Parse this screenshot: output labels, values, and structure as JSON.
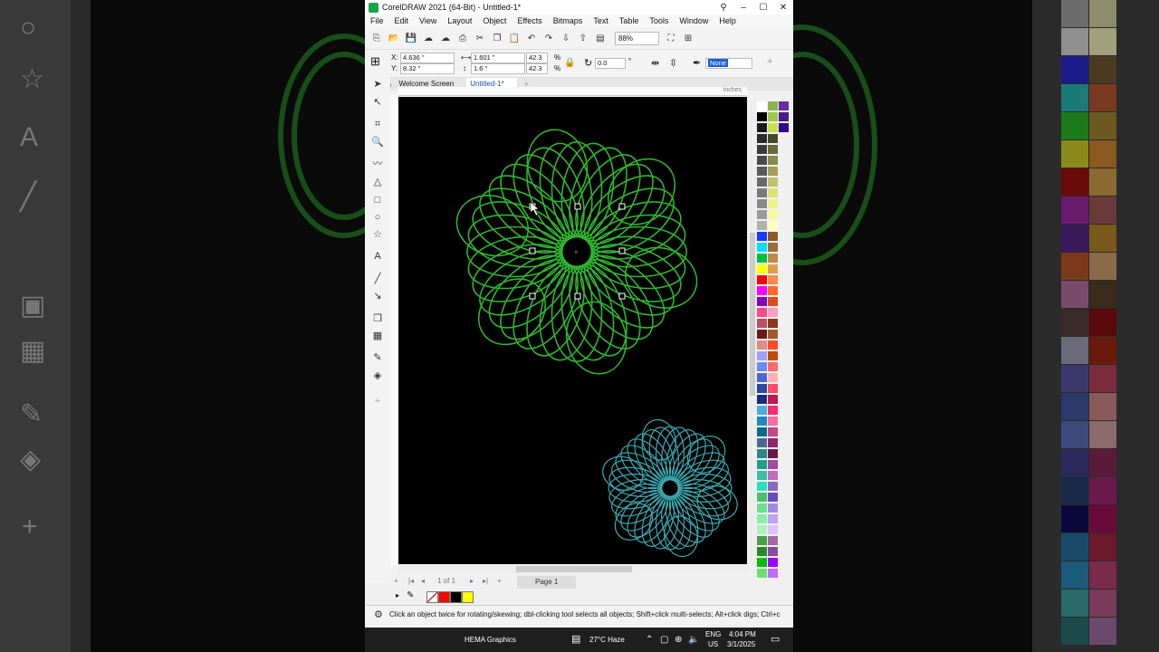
{
  "window": {
    "title": "CorelDRAW 2021 (64-Bit) - Untitled-1*",
    "controls": [
      "–",
      "☐",
      "✕"
    ]
  },
  "menu": [
    "File",
    "Edit",
    "View",
    "Layout",
    "Object",
    "Effects",
    "Bitmaps",
    "Text",
    "Table",
    "Tools",
    "Window",
    "Help"
  ],
  "toolbar": {
    "zoom": "88%"
  },
  "property_bar": {
    "x": "4.636 \"",
    "y": "8.32 \"",
    "width": "1.601 \"",
    "height": "1.6 \"",
    "scale_x": "42.3",
    "scale_y": "42.3",
    "pct": "%",
    "angle": "0.0",
    "angle_unit": "°",
    "outline": "None"
  },
  "tabs": [
    "Welcome Screen",
    "Untitled-1*"
  ],
  "ruler": {
    "unit": "inches"
  },
  "pages": {
    "count": "1 of 1",
    "page_tab": "Page 1"
  },
  "document_palette": {
    "colors": [
      "#ff0000",
      "#000000",
      "#ffff00"
    ]
  },
  "status_text": "Click an object twice for rotating/skewing; dbl-clicking tool selects all objects; Shift+click multi-selects; Alt+click digs; Ctrl+c",
  "taskbar": {
    "app": "HEMA Graphics",
    "weather": "27°C  Haze",
    "lang1": "ENG",
    "lang2": "US",
    "time": "4:04 PM",
    "date": "3/1/2025"
  },
  "artwork": {
    "flower_large_color": "#2fb52f",
    "flower_small_color": "#3aa9b3"
  },
  "icons": {
    "tools": [
      "pick-tool-icon",
      "shape-tool-icon",
      "crop-tool-icon",
      "zoom-tool-icon",
      "curve-tool-icon",
      "artistic-media-icon",
      "rectangle-tool-icon",
      "ellipse-tool-icon",
      "polygon-tool-icon",
      "text-tool-icon",
      "parallel-dimension-icon",
      "connector-tool-icon",
      "drop-shadow-icon",
      "transparency-icon",
      "eyedropper-icon",
      "interactive-fill-icon",
      "add-tool-icon"
    ]
  }
}
